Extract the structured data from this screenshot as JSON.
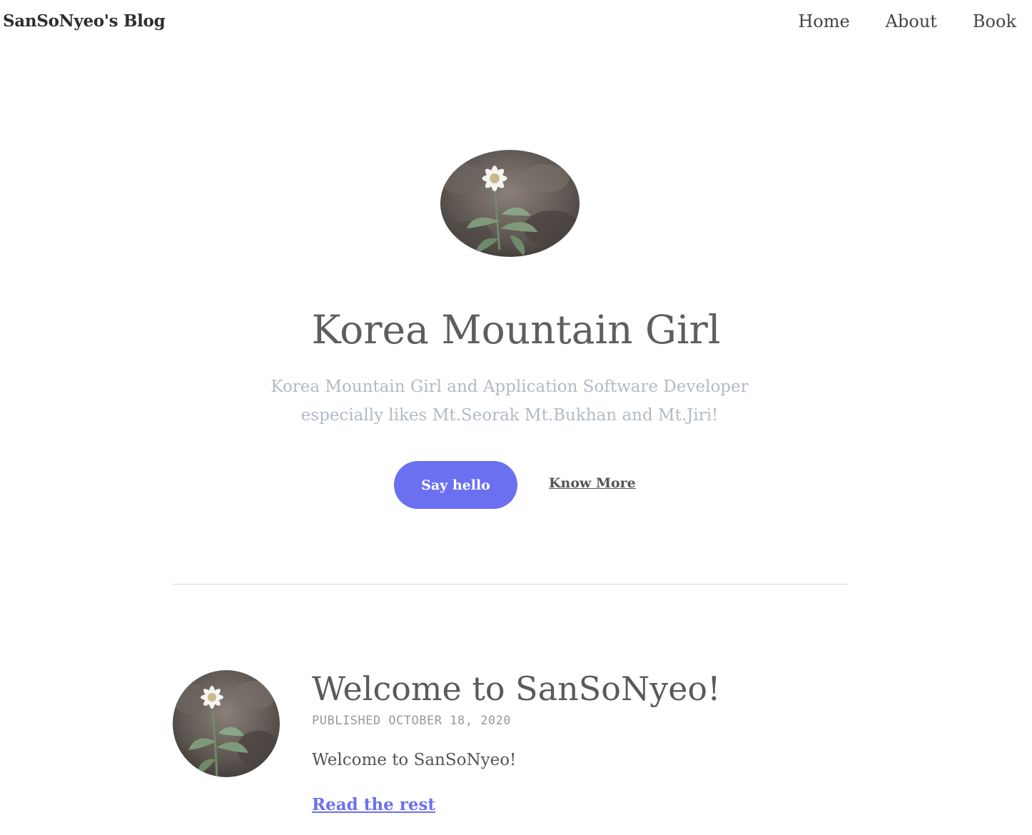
{
  "header": {
    "brand": "SanSoNyeo's Blog",
    "nav": [
      {
        "label": "Home"
      },
      {
        "label": "About"
      },
      {
        "label": "Book"
      }
    ]
  },
  "hero": {
    "avatar_icon": "edelweiss-photo",
    "title": "Korea Mountain Girl",
    "subtitle": "Korea Mountain Girl and Application Software Developer especially likes Mt.Seorak Mt.Bukhan and Mt.Jiri!",
    "primary_button": "Say hello",
    "secondary_link": "Know More"
  },
  "posts": [
    {
      "avatar_icon": "edelweiss-photo",
      "title": "Welcome to SanSoNyeo!",
      "meta": "PUBLISHED OCTOBER 18, 2020",
      "excerpt": "Welcome to SanSoNyeo!",
      "read_more": "Read the rest"
    }
  ],
  "colors": {
    "accent": "#6b70f0",
    "subtitle": "#b3b9c5"
  }
}
